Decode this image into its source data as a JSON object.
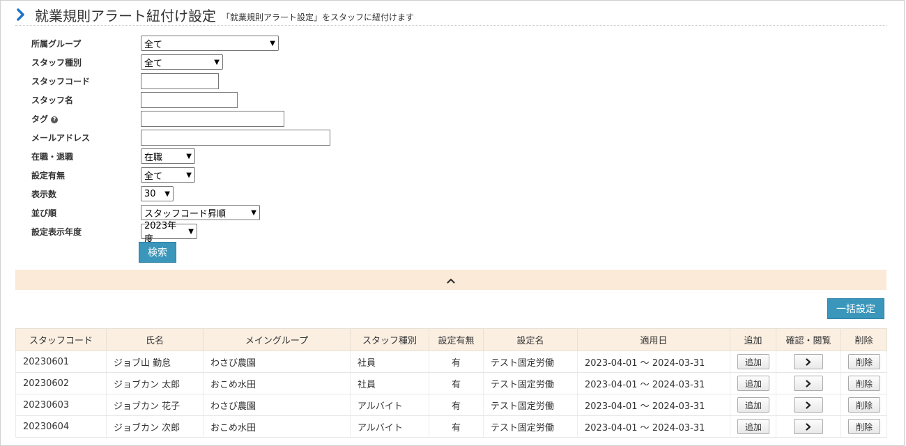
{
  "header": {
    "title": "就業規則アラート紐付け設定",
    "subtitle": "「就業規則アラート設定」をスタッフに紐付けます"
  },
  "filters": {
    "group": {
      "label": "所属グループ",
      "value": "全て"
    },
    "staff_type": {
      "label": "スタッフ種別",
      "value": "全て"
    },
    "staff_code": {
      "label": "スタッフコード",
      "value": ""
    },
    "staff_name": {
      "label": "スタッフ名",
      "value": ""
    },
    "tag": {
      "label": "タグ",
      "value": ""
    },
    "email": {
      "label": "メールアドレス",
      "value": ""
    },
    "employment": {
      "label": "在職・退職",
      "value": "在職"
    },
    "setting": {
      "label": "設定有無",
      "value": "全て"
    },
    "display_count": {
      "label": "表示数",
      "value": "30"
    },
    "sort": {
      "label": "並び順",
      "value": "スタッフコード昇順"
    },
    "year": {
      "label": "設定表示年度",
      "value": "2023年度"
    },
    "search_label": "検索"
  },
  "actions": {
    "bulk_label": "一括設定"
  },
  "table": {
    "headers": [
      "スタッフコード",
      "氏名",
      "メイングループ",
      "スタッフ種別",
      "設定有無",
      "設定名",
      "適用日",
      "追加",
      "確認・閲覧",
      "削除"
    ],
    "add_label": "追加",
    "delete_label": "削除",
    "rows": [
      {
        "code": "20230601",
        "name": "ジョブ山 勤怠",
        "group": "わさび農園",
        "type": "社員",
        "has": "有",
        "setting": "テスト固定労働",
        "period": "2023-04-01 ～ 2024-03-31"
      },
      {
        "code": "20230602",
        "name": "ジョブカン 太郎",
        "group": "おこめ水田",
        "type": "社員",
        "has": "有",
        "setting": "テスト固定労働",
        "period": "2023-04-01 ～ 2024-03-31"
      },
      {
        "code": "20230603",
        "name": "ジョブカン 花子",
        "group": "わさび農園",
        "type": "アルバイト",
        "has": "有",
        "setting": "テスト固定労働",
        "period": "2023-04-01 ～ 2024-03-31"
      },
      {
        "code": "20230604",
        "name": "ジョブカン 次郎",
        "group": "おこめ水田",
        "type": "アルバイト",
        "has": "有",
        "setting": "テスト固定労働",
        "period": "2023-04-01 ～ 2024-03-31"
      }
    ]
  },
  "colors": {
    "accent": "#3a97bb",
    "header_bg": "#fbefe2",
    "collapse_bg": "#faead7",
    "chevron": "#1a73c8"
  }
}
